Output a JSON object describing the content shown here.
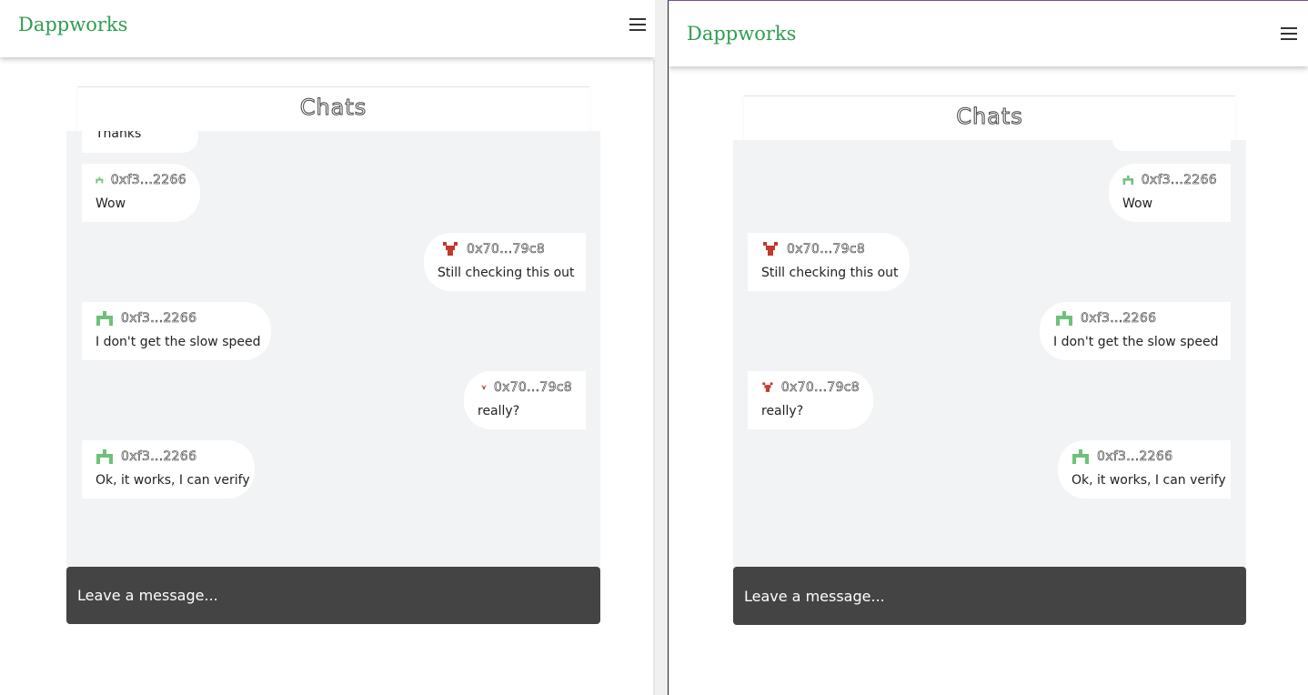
{
  "app": {
    "brand": "Dappworks"
  },
  "chat": {
    "title": "Chats",
    "input_placeholder": "Leave a message...",
    "partial_top_text": "Thanks",
    "messages": [
      {
        "address": "0xf3...2266",
        "text": "Wow",
        "avatar": "green-robot-icon"
      },
      {
        "address": "0x70...79c8",
        "text": "Still checking this out",
        "avatar": "red-robot-icon"
      },
      {
        "address": "0xf3...2266",
        "text": "I don't get the slow speed",
        "avatar": "green-robot-icon"
      },
      {
        "address": "0x70...79c8",
        "text": "really?",
        "avatar": "red-robot-icon"
      },
      {
        "address": "0xf3...2266",
        "text": "Ok, it works, I can verify",
        "avatar": "green-robot-icon"
      }
    ]
  },
  "colors": {
    "brand": "#2e9e4f",
    "input_bg": "#444444",
    "chat_bg": "#f2f3f5"
  }
}
